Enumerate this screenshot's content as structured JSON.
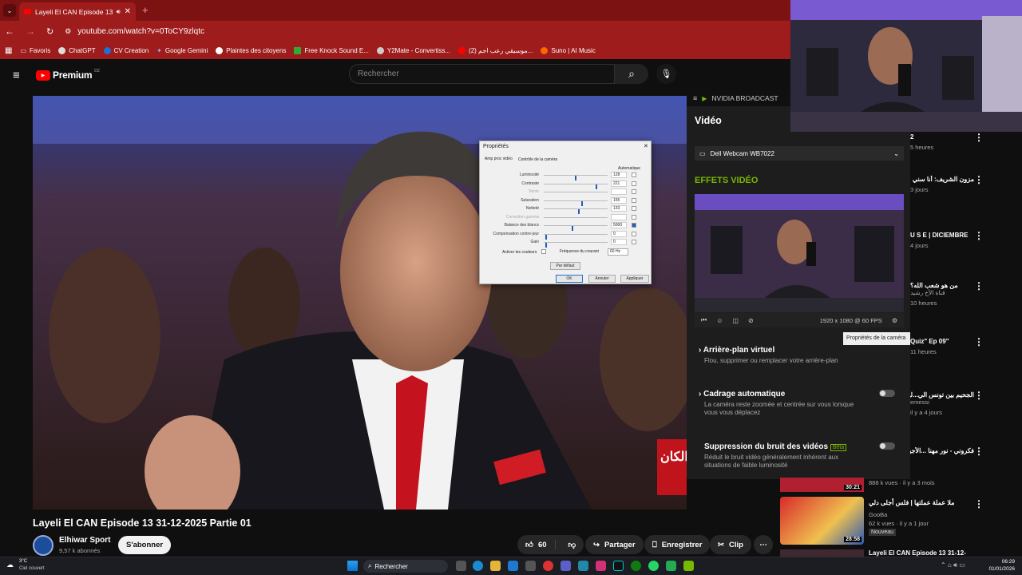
{
  "browser": {
    "tab_title": "Layeli El CAN Episode 13 3",
    "url": "youtube.com/watch?v=0ToCY9zlqtc",
    "bookmarks": [
      "Favoris",
      "ChatGPT",
      "CV Creation",
      "Google Gemini",
      "Plaintes des citoyens",
      "Free Knock Sound E...",
      "Y2Mate - Convertiss...",
      "(2) موسيقي رعب اجم...",
      "Suno | AI Music"
    ]
  },
  "youtube": {
    "logo": "Premium",
    "region": "DZ",
    "search_placeholder": "Rechercher",
    "video_title": "Layeli El CAN Episode 13 31-12-2025 Partie 01",
    "channel_name": "Elhiwar Sport",
    "subscribers": "9,57 k abonnés",
    "subscribe_label": "S'abonner",
    "likes": "60",
    "share_label": "Partager",
    "save_label": "Enregistrer",
    "clip_label": "Clip"
  },
  "dialog": {
    "title": "Propriétés",
    "tabs": [
      "Amp proc vidéo",
      "Contrôle de la caméra"
    ],
    "auto_label": "Automatique",
    "rows": [
      {
        "label": "Luminosité",
        "value": "128"
      },
      {
        "label": "Contraste",
        "value": "221"
      },
      {
        "label": "Teinte",
        "value": ""
      },
      {
        "label": "Saturation",
        "value": "155"
      },
      {
        "label": "Netteté",
        "value": "133"
      },
      {
        "label": "Correction gamma",
        "value": ""
      },
      {
        "label": "Balance des blancs",
        "value": "5000"
      },
      {
        "label": "Compensation contre-jour",
        "value": "0"
      },
      {
        "label": "Gain",
        "value": "0"
      }
    ],
    "color_label": "Activer les couleurs",
    "freq_label": "Fréquence du courant",
    "freq_value": "60 Hz",
    "default_label": "Par défaut",
    "ok_label": "OK",
    "cancel_label": "Annuler",
    "apply_label": "Appliquer"
  },
  "nvidia": {
    "app_title": "NVIDIA BROADCAST",
    "section": "Vidéo",
    "device": "Dell Webcam WB7022",
    "effects_title": "EFFETS VIDÉO",
    "resolution": "1920 x 1080 @ 60 FPS",
    "tooltip": "Propriétés de la caméra",
    "effects": [
      {
        "title": "Arrière-plan virtuel",
        "desc": "Flou, supprimer ou remplacer votre arrière-plan"
      },
      {
        "title": "Cadrage automatique",
        "desc": "La caméra reste zoomée et centrée sur vous lorsque vous vous déplacez"
      },
      {
        "title": "Suppression du bruit des vidéos",
        "badge": "Bêta",
        "desc": "Réduit le bruit vidéo généralement inhérent aux situations de faible luminosité"
      }
    ]
  },
  "sidebar": {
    "items": [
      {
        "title": "2",
        "meta": "5 heures"
      },
      {
        "title": "مزون الشريف: أنا سني ...سول ويصرح علي ظلم",
        "meta": "3 jours"
      },
      {
        "title": "U S E | DICIEMBRE",
        "meta": "4 jours"
      },
      {
        "title": "من هو شعب الله؟",
        "sub": "قناة الأخ رشيد",
        "meta": "10 heures"
      },
      {
        "title": "\"Quiz\" Ep 09",
        "meta": "11 heures"
      },
      {
        "title": "الجحيم بين تونس الي...لهجرة ،السجن و الاختطـ...",
        "sub": "emessi",
        "meta": "il y a 4 jours"
      },
      {
        "title": "فكروني - نور مهنا ...الأجيال \"محمد عبدالوهـ",
        "meta": ""
      }
    ],
    "thumbs": [
      {
        "duration": "30:21",
        "views": "888 k vues · il y a 3 mois",
        "channel": ""
      },
      {
        "duration": "28:58",
        "title": "ملا عملة عملتها | فلس أجلى دلي",
        "channel": "GooBa",
        "views": "62 k vues · il y a 1 jour",
        "badge": "Nouveau"
      },
      {
        "title": "Layeli El CAN Episode 13 31-12-",
        "channel": "",
        "views": "",
        "duration": ""
      }
    ]
  },
  "video_overlay_text": "الكان",
  "taskbar": {
    "temp": "3°C",
    "weather": "Ciel couvert",
    "search": "Rechercher",
    "time": "06:29",
    "date": "01/01/2026"
  },
  "colors": {
    "chrome": "#9e1c1c",
    "nvidia_green": "#76b900",
    "youtube_red": "#ff0000"
  }
}
